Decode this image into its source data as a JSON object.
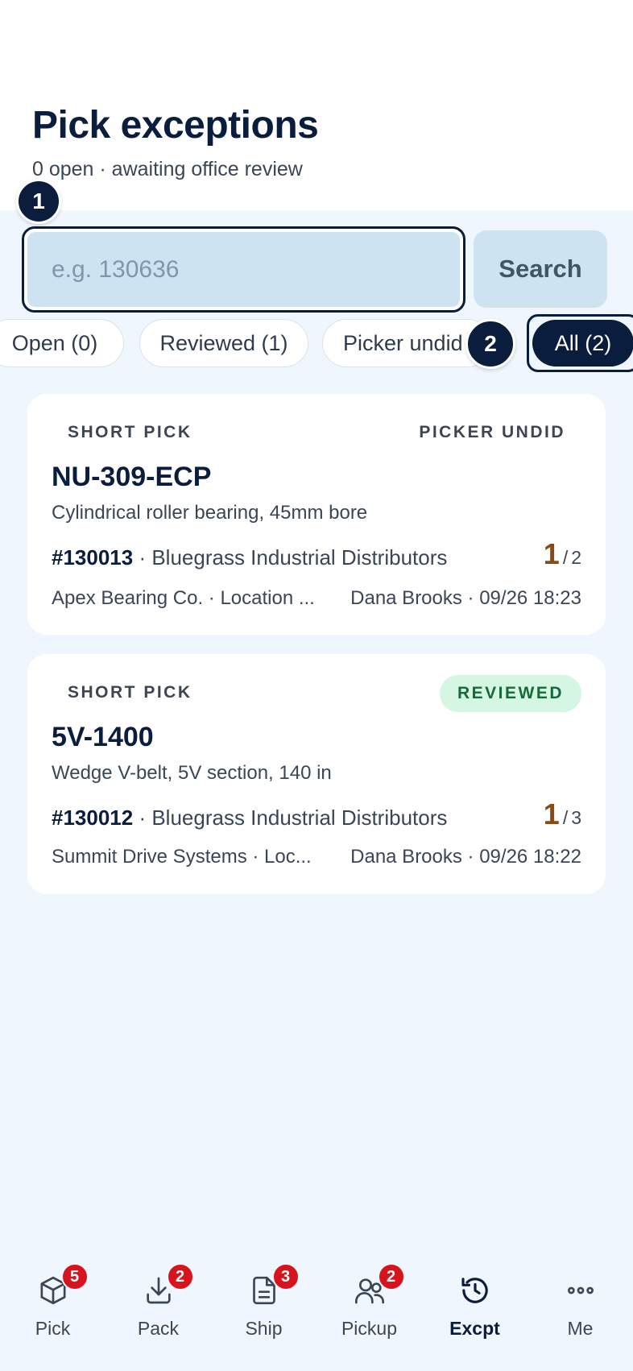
{
  "header": {
    "title": "Pick exceptions",
    "subtitle": "0 open · awaiting office review"
  },
  "steps": [
    "1",
    "2"
  ],
  "search": {
    "placeholder": "e.g. 130636",
    "value": "",
    "button_label": "Search"
  },
  "filters": [
    {
      "label": "Open (0)",
      "active": false
    },
    {
      "label": "Reviewed (1)",
      "active": false
    },
    {
      "label": "Picker undid",
      "active": false
    },
    {
      "label": "All (2)",
      "active": true
    }
  ],
  "exceptions": [
    {
      "type": "SHORT PICK",
      "status": "PICKER UNDID",
      "sku": "NU-309-ECP",
      "description": "Cylindrical roller bearing, 45mm bore",
      "order_number": "#130013",
      "order_sep": " · ",
      "customer": "Bluegrass Industrial Distributors",
      "qty_picked": "1",
      "qty_sep": "/",
      "qty_total": "2",
      "supplier_location": "Apex Bearing Co. · Location ...",
      "picker_time": "Dana Brooks · 09/26 18:23"
    },
    {
      "type": "SHORT PICK",
      "status": "REVIEWED",
      "sku": "5V-1400",
      "description": "Wedge V-belt, 5V section, 140 in",
      "order_number": "#130012",
      "order_sep": " · ",
      "customer": "Bluegrass Industrial Distributors",
      "qty_picked": "1",
      "qty_sep": "/",
      "qty_total": "3",
      "supplier_location": "Summit Drive Systems · Loc...",
      "picker_time": "Dana Brooks · 09/26 18:22"
    }
  ],
  "bottom_nav": [
    {
      "label": "Pick",
      "icon": "box-icon",
      "badge": "5",
      "active": false
    },
    {
      "label": "Pack",
      "icon": "download-icon",
      "badge": "2",
      "active": false
    },
    {
      "label": "Ship",
      "icon": "document-icon",
      "badge": "3",
      "active": false
    },
    {
      "label": "Pickup",
      "icon": "users-icon",
      "badge": "2",
      "active": false
    },
    {
      "label": "Excpt",
      "icon": "history-icon",
      "badge": "",
      "active": true
    },
    {
      "label": "Me",
      "icon": "more-icon",
      "badge": "",
      "active": false
    }
  ],
  "colors": {
    "navy": "#0b1d3d",
    "badge_red": "#d7141d",
    "qty_orange": "#8a4b12",
    "reviewed_green": "#17693a"
  }
}
